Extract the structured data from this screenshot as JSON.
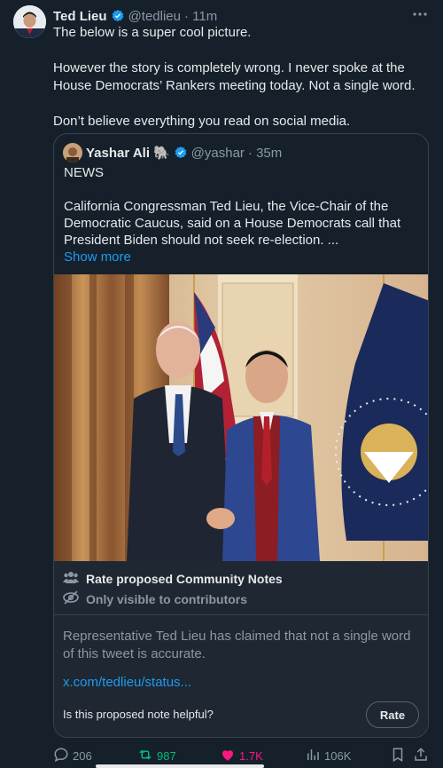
{
  "tweet": {
    "author_name": "Ted Lieu",
    "handle": "@tedlieu",
    "time": "· 11m",
    "paragraphs": [
      "The below is a super cool picture.",
      "However the story is completely wrong. I never spoke at the House Democrats’ Rankers meeting today. Not a single word.",
      "Don’t believe everything you read on social media."
    ]
  },
  "quote": {
    "author_name": "Yashar Ali",
    "emoji": "🐘",
    "handle": "@yashar",
    "time": "· 35m",
    "paragraphs": [
      "NEWS",
      "California Congressman Ted Lieu, the Vice-Chair of the Democratic Caucus, said on a House Democrats call that President Biden should not seek re-election. ..."
    ],
    "show_more": "Show more"
  },
  "community_notes": {
    "title": "Rate proposed Community Notes",
    "visibility": "Only visible to contributors",
    "note_text": "Representative Ted Lieu has claimed that not a single word of this tweet is accurate.",
    "link": "x.com/tedlieu/status...",
    "question": "Is this proposed note helpful?",
    "rate_label": "Rate"
  },
  "actions": {
    "replies": "206",
    "retweets": "987",
    "likes": "1.7K",
    "views": "106K"
  },
  "colors": {
    "background": "#15202b",
    "accent": "#1d9bf0",
    "retweet": "#00ba7c",
    "like": "#f91880"
  }
}
